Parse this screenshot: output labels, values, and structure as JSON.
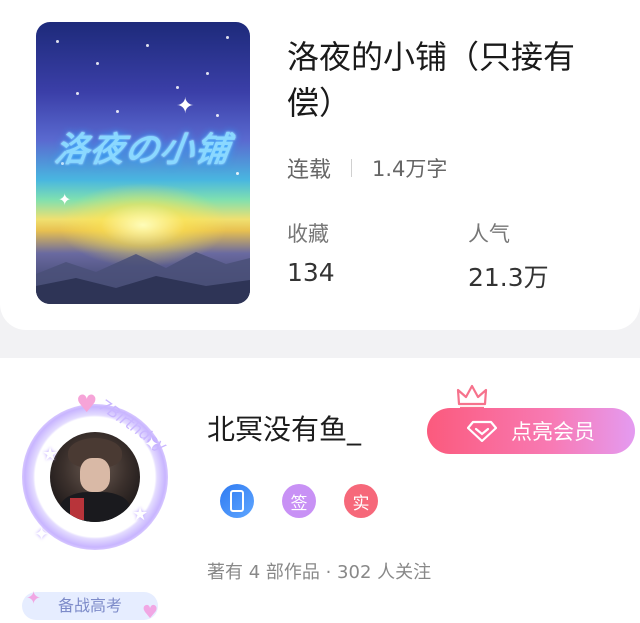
{
  "book": {
    "cover_title": "洛夜の小铺",
    "title": "洛夜的小铺（只接有偿）",
    "status": "连载",
    "word_count": "1.4万字",
    "favorites_label": "收藏",
    "favorites_value": "134",
    "popularity_label": "人气",
    "popularity_value": "21.3万"
  },
  "author": {
    "name": "北冥没有鱼_",
    "vip_button_label": "点亮会员",
    "badge_text": "备战高考",
    "avatar_frame_text": "7Birthday",
    "tags": [
      {
        "icon": "phone-verified-icon",
        "label": ""
      },
      {
        "icon": "signed-icon",
        "label": "签"
      },
      {
        "icon": "verified-real-icon",
        "label": "实"
      }
    ],
    "stats_text": "著有 4 部作品 · 302 人关注"
  },
  "colors": {
    "vip_gradient_start": "#fb5a7d",
    "vip_gradient_end": "#e49bf1",
    "tag_phone": "#2f7bf2",
    "tag_sign": "#c891f5",
    "tag_real": "#f6687a"
  }
}
